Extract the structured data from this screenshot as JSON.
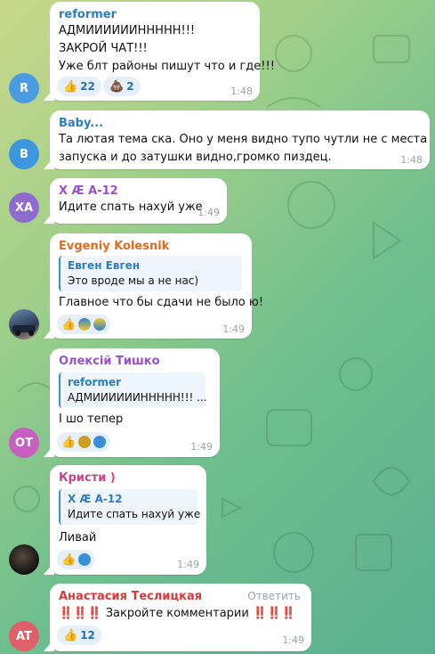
{
  "messages": [
    {
      "id": "m1",
      "avatar_text": "R",
      "avatar_color": "#4a9be0",
      "name": "reformer",
      "name_color": "#2a7fc4",
      "lines": [
        "АДМИИИИИИННННН!!!",
        "ЗАКРОЙ ЧАТ!!!",
        "Уже блт районы пишут что и где!!!"
      ],
      "reactions": [
        {
          "emoji": "👍",
          "count": "22"
        },
        {
          "emoji": "💩",
          "count": "2"
        }
      ],
      "time": "1:48"
    },
    {
      "id": "m2",
      "avatar_text": "B",
      "avatar_color": "#3e96de",
      "name": "Baby...",
      "name_color": "#2a7fc4",
      "lines": [
        "Та лютая тема ска. Оно у меня видно тупо чутли не с места",
        "запуска и до затушки видно,громко пиздец."
      ],
      "time": "1:48"
    },
    {
      "id": "m3",
      "avatar_text": "ХА",
      "avatar_color": "#8e6ccf",
      "name": "Х Æ А-12",
      "name_color": "#9a4fd0",
      "lines": [
        "Идите спать нахуй уже"
      ],
      "time": "1:49"
    },
    {
      "id": "m4",
      "name": "Evgeniy Kolesnik",
      "name_color": "#e06c20",
      "reply_name": "Евген Евген",
      "reply_text": "Это вроде мы а не нас)",
      "lines": [
        "Главное что бы сдачи не было ю!"
      ],
      "time": "1:49"
    },
    {
      "id": "m5",
      "avatar_text": "OT",
      "avatar_color": "#c75fc0",
      "name": "Олексій Тишко",
      "name_color": "#9a4fd0",
      "reply_name": "reformer",
      "reply_text": "АДМИИИИИИННННН!!! ...",
      "lines": [
        "І шо тепер"
      ],
      "time": "1:49"
    },
    {
      "id": "m6",
      "name": "Кристи )",
      "name_color": "#d0408a",
      "reply_name": "Х Æ А-12",
      "reply_text": "Идите спать нахуй уже",
      "lines": [
        "Ливай"
      ],
      "time": "1:49"
    },
    {
      "id": "m7",
      "avatar_text": "AT",
      "avatar_color": "#e0606a",
      "name": "Анастасия Теслицкая",
      "name_color": "#d83a3a",
      "reply_action": "Ответить",
      "text_main": "Закройте комментарии",
      "marks": "‼️‼️‼️",
      "reactions": [
        {
          "emoji": "👍",
          "count": "12"
        }
      ],
      "time": "1:49"
    }
  ]
}
